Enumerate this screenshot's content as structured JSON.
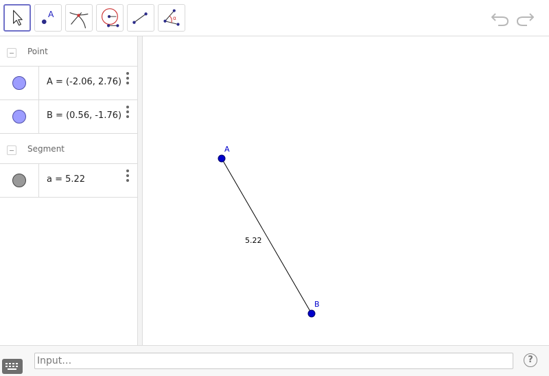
{
  "toolbar": {
    "tools": [
      {
        "name": "Move",
        "icon": "move-arrow-icon",
        "selected": true
      },
      {
        "name": "Point",
        "icon": "point-tool-icon",
        "label": "A"
      },
      {
        "name": "Intersect",
        "icon": "intersect-tool-icon"
      },
      {
        "name": "Circle",
        "icon": "circle-tool-icon"
      },
      {
        "name": "Segment",
        "icon": "segment-tool-icon"
      },
      {
        "name": "Angle",
        "icon": "angle-tool-icon",
        "label": "α"
      }
    ],
    "undo_icon": "undo-icon",
    "redo_icon": "redo-icon"
  },
  "algebra": {
    "groups": [
      {
        "label": "Point",
        "items": [
          {
            "text": "A = (-2.06, 2.76)",
            "kind": "point",
            "color": "#9d9dff"
          },
          {
            "text": "B = (0.56, -1.76)",
            "kind": "point",
            "color": "#9d9dff"
          }
        ]
      },
      {
        "label": "Segment",
        "items": [
          {
            "text": "a = 5.22",
            "kind": "segment",
            "color": "#999999"
          }
        ]
      }
    ]
  },
  "graphics": {
    "points": [
      {
        "label": "A",
        "color": "#0000cc"
      },
      {
        "label": "B",
        "color": "#0000cc"
      }
    ],
    "segment": {
      "label": "5.22",
      "color": "#000000"
    }
  },
  "inputbar": {
    "placeholder": "Input…",
    "help_label": "?"
  }
}
